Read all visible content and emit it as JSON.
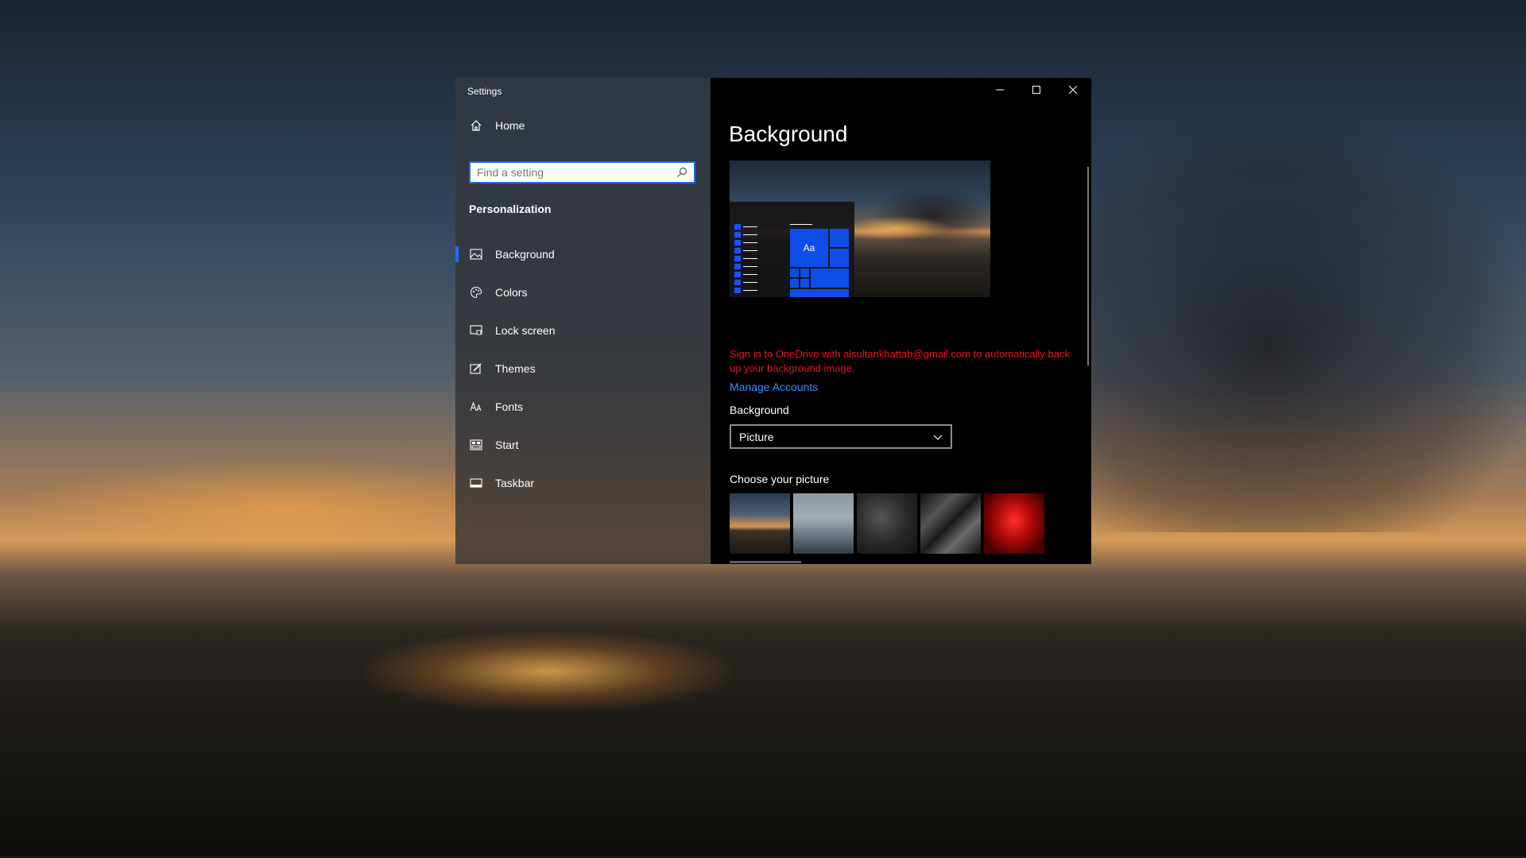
{
  "window": {
    "app_title": "Settings",
    "controls": {
      "minimize": "minimize-icon",
      "maximize": "maximize-icon",
      "close": "close-icon"
    }
  },
  "sidebar": {
    "home_label": "Home",
    "search_placeholder": "Find a setting",
    "section_title": "Personalization",
    "items": [
      {
        "label": "Background",
        "icon": "picture-icon",
        "selected": true
      },
      {
        "label": "Colors",
        "icon": "palette-icon"
      },
      {
        "label": "Lock screen",
        "icon": "lock-screen-icon"
      },
      {
        "label": "Themes",
        "icon": "brush-icon"
      },
      {
        "label": "Fonts",
        "icon": "font-icon"
      },
      {
        "label": "Start",
        "icon": "start-icon"
      },
      {
        "label": "Taskbar",
        "icon": "taskbar-icon"
      }
    ]
  },
  "content": {
    "page_title": "Background",
    "preview": {
      "tile_label": "Aa"
    },
    "onedrive_notice": "Sign in to OneDrive with alsultankhattab@gmail.com to automatically back up your background image.",
    "manage_accounts_link": "Manage Accounts",
    "background_label": "Background",
    "background_value": "Picture",
    "choose_picture_label": "Choose your picture"
  },
  "colors": {
    "accent": "#1e6fff",
    "tile": "#0f4de8",
    "notice": "#e81123",
    "link": "#3c8cff"
  }
}
